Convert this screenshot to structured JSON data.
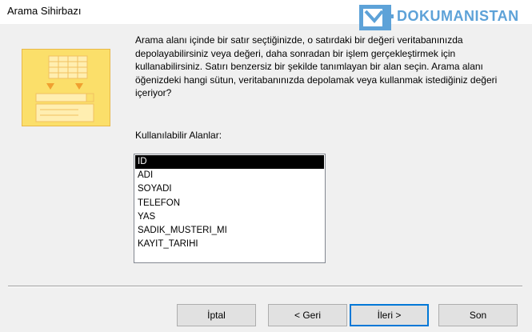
{
  "window": {
    "title": "Arama Sihirbazı"
  },
  "watermark": {
    "text": "DOKUMANISTAN"
  },
  "description": "Arama alanı içinde bir satır seçtiğinizde, o satırdaki bir değeri veritabanınızda depolayabilirsiniz veya değeri, daha sonradan bir işlem gerçekleştirmek için kullanabilirsiniz. Satırı benzersiz bir şekilde tanımlayan bir alan seçin. Arama alanı öğenizdeki hangi sütun, veritabanınızda depolamak veya kullanmak istediğiniz değeri içeriyor?",
  "fields": {
    "label": "Kullanılabilir Alanlar:",
    "items": [
      "ID",
      "ADI",
      "SOYADI",
      "TELEFON",
      "YAS",
      "SADIK_MUSTERI_MI",
      "KAYIT_TARIHI"
    ],
    "selected": "ID"
  },
  "buttons": {
    "cancel": "İptal",
    "back": "< Geri",
    "next": "İleri >",
    "finish": "Son"
  },
  "colors": {
    "icon_fill": "#fbdf6a",
    "icon_arrow": "#f0a030",
    "watermark": "#5da2d8",
    "default_button_border": "#0078d7"
  },
  "icons": {
    "wizard": "table-lookup-wizard-icon",
    "watermark_logo": "document-logo-icon"
  }
}
